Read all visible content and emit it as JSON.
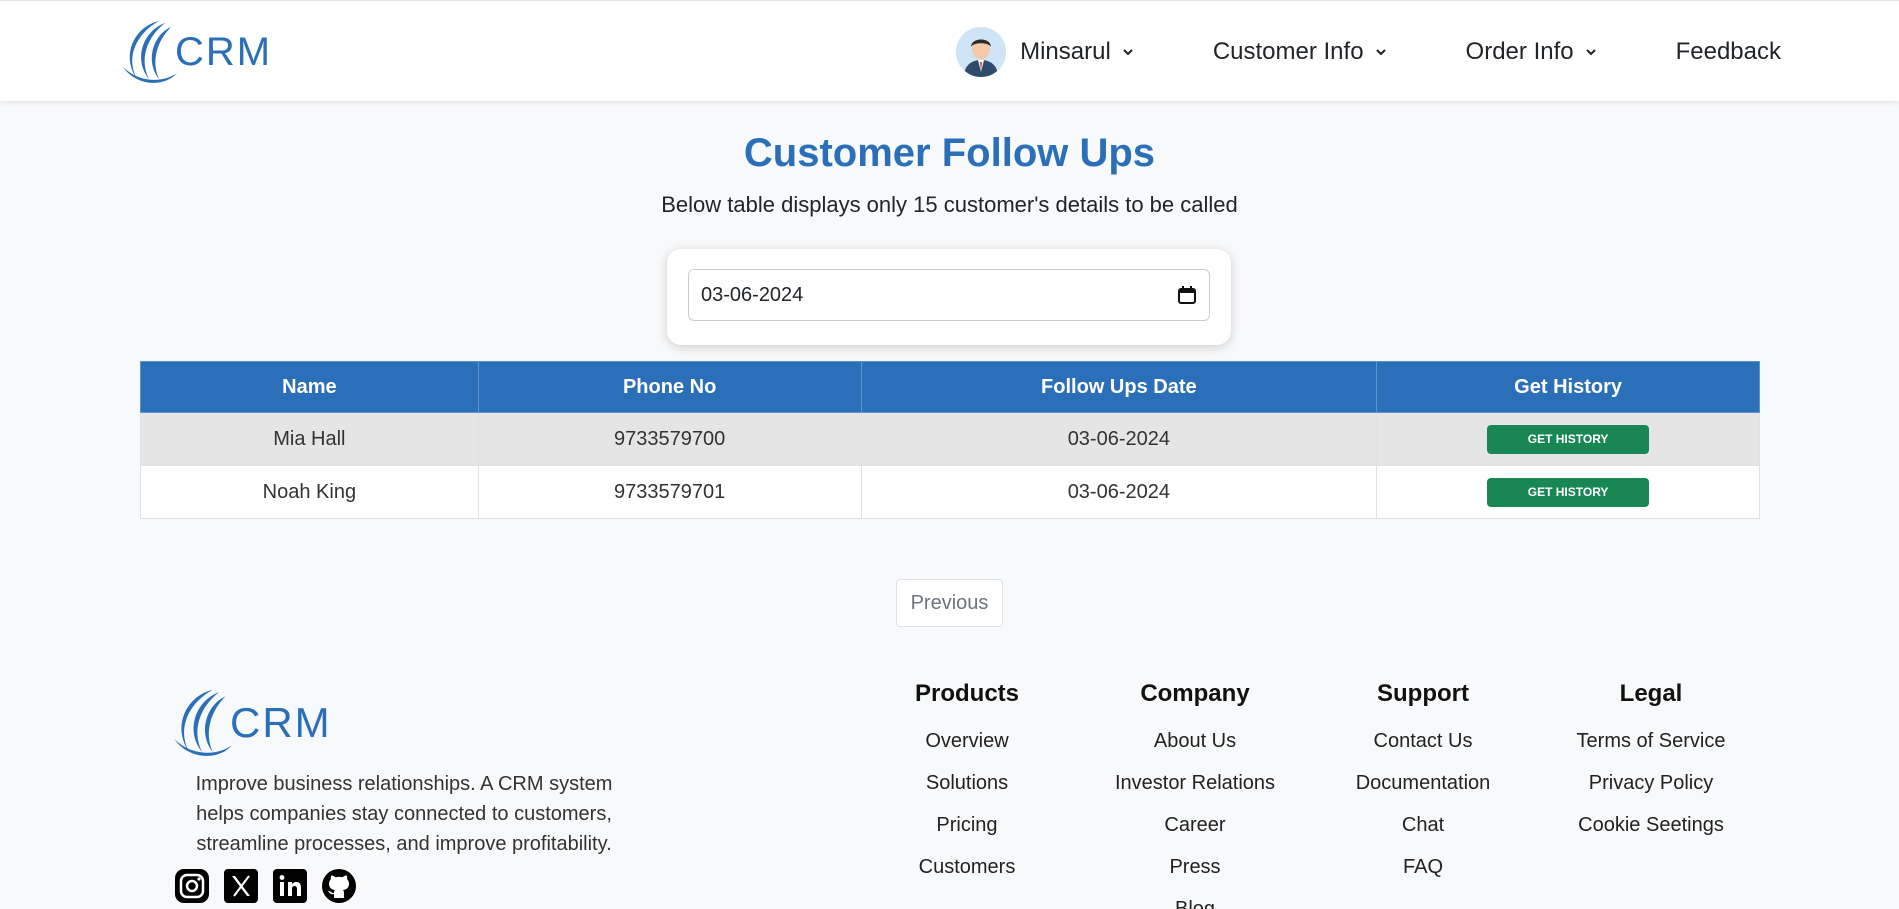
{
  "brand": {
    "logo_text": "CRM"
  },
  "navbar": {
    "user_name": "Minsarul",
    "customer_info": "Customer Info",
    "order_info": "Order Info",
    "feedback": "Feedback"
  },
  "main": {
    "title": "Customer Follow Ups",
    "subtitle": "Below table displays only 15 customer's details to be called",
    "date_value": "03-06-2024"
  },
  "table": {
    "headers": [
      "Name",
      "Phone No",
      "Follow Ups Date",
      "Get History"
    ],
    "rows": [
      {
        "name": "Mia Hall",
        "phone": "9733579700",
        "date": "03-06-2024",
        "action": "GET HISTORY"
      },
      {
        "name": "Noah King",
        "phone": "9733579701",
        "date": "03-06-2024",
        "action": "GET HISTORY"
      }
    ]
  },
  "pagination": {
    "previous": "Previous"
  },
  "footer": {
    "description": "Improve business relationships. A CRM system helps companies stay connected to customers, streamline processes, and improve profitability.",
    "social_icons": [
      "instagram-icon",
      "x-icon",
      "linkedin-icon",
      "github-icon"
    ],
    "columns": [
      {
        "title": "Products",
        "links": [
          "Overview",
          "Solutions",
          "Pricing",
          "Customers"
        ]
      },
      {
        "title": "Company",
        "links": [
          "About Us",
          "Investor Relations",
          "Career",
          "Press",
          "Blog"
        ]
      },
      {
        "title": "Support",
        "links": [
          "Contact Us",
          "Documentation",
          "Chat",
          "FAQ"
        ]
      },
      {
        "title": "Legal",
        "links": [
          "Terms of Service",
          "Privacy Policy",
          "Cookie Seetings"
        ]
      }
    ]
  },
  "colors": {
    "brand_blue": "#2a6fb8",
    "history_green": "#198754"
  }
}
